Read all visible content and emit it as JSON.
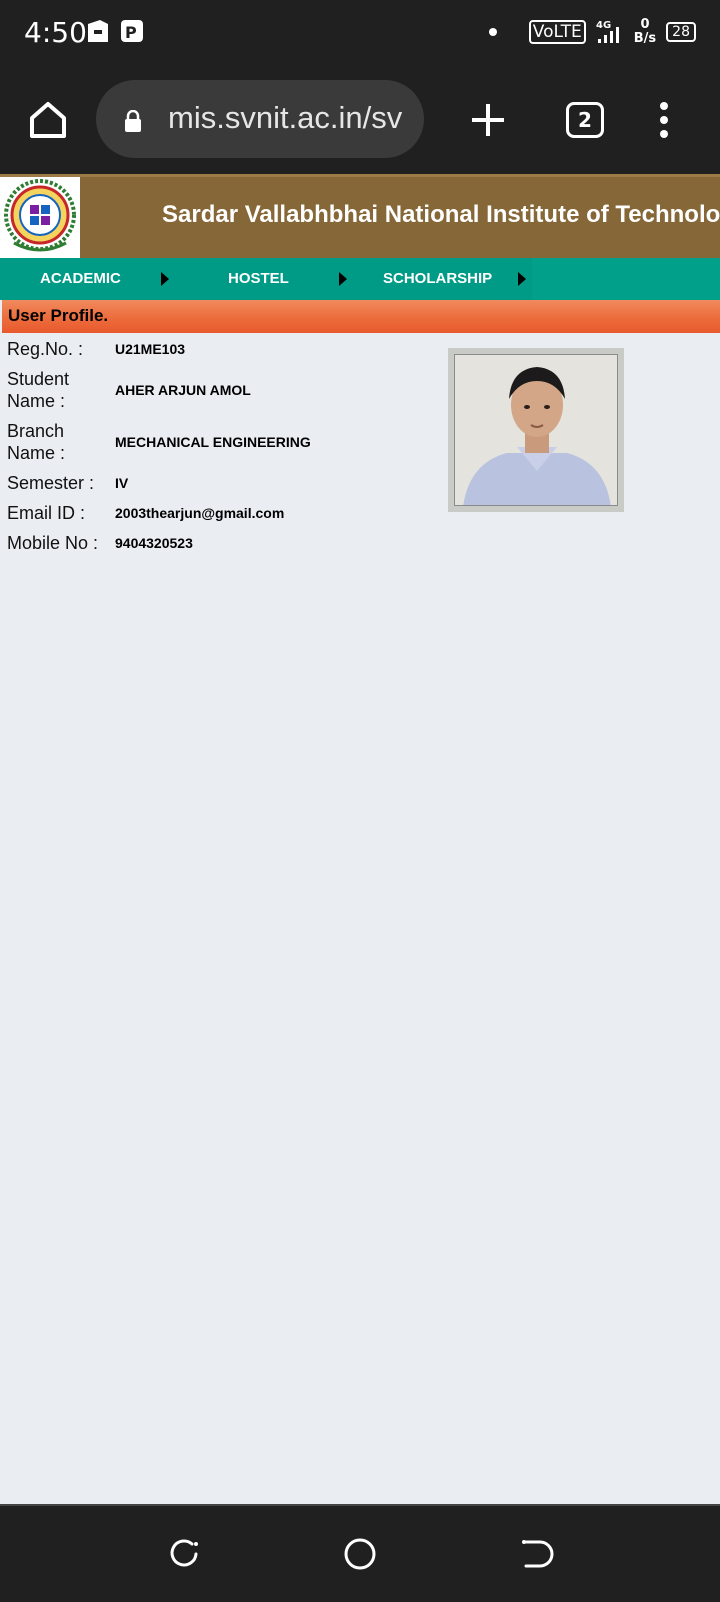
{
  "status_bar": {
    "time": "4:50",
    "network_label": "VoLTE",
    "network_type": "4G",
    "speed_value": "0",
    "speed_unit": "B/s",
    "battery": "28"
  },
  "browser": {
    "url": "mis.svnit.ac.in/sv",
    "tab_count": "2"
  },
  "site": {
    "title": "Sardar Vallabhbhai National Institute of Technology"
  },
  "nav": {
    "items": [
      {
        "label": "ACADEMIC"
      },
      {
        "label": "HOSTEL"
      },
      {
        "label": "SCHOLARSHIP"
      }
    ]
  },
  "profile": {
    "section_title": "User Profile.",
    "fields": [
      {
        "label": "Reg.No. :",
        "value": "U21ME103"
      },
      {
        "label": "Student Name :",
        "value": "AHER ARJUN AMOL"
      },
      {
        "label": "Branch Name :",
        "value": "MECHANICAL ENGINEERING"
      },
      {
        "label": "Semester :",
        "value": "IV"
      },
      {
        "label": "Email ID :",
        "value": "2003thearjun@gmail.com"
      },
      {
        "label": "Mobile No :",
        "value": "9404320523"
      }
    ]
  },
  "colors": {
    "header_brown": "#866737",
    "nav_teal": "#009b87",
    "section_orange": "#ec6a3a",
    "page_bg": "#eaeef3"
  }
}
